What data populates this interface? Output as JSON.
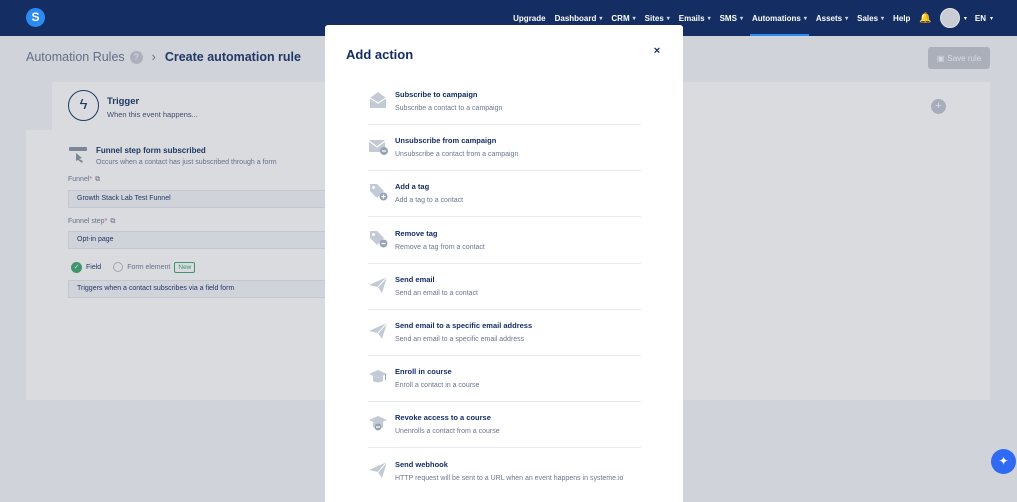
{
  "nav": {
    "items": [
      {
        "label": "Upgrade",
        "dropdown": false,
        "active": false
      },
      {
        "label": "Dashboard",
        "dropdown": true,
        "active": false
      },
      {
        "label": "CRM",
        "dropdown": true,
        "active": false
      },
      {
        "label": "Sites",
        "dropdown": true,
        "active": false
      },
      {
        "label": "Emails",
        "dropdown": true,
        "active": false
      },
      {
        "label": "SMS",
        "dropdown": true,
        "active": false
      },
      {
        "label": "Automations",
        "dropdown": true,
        "active": true
      },
      {
        "label": "Assets",
        "dropdown": true,
        "active": false
      },
      {
        "label": "Sales",
        "dropdown": true,
        "active": false
      },
      {
        "label": "Help",
        "dropdown": false,
        "active": false
      }
    ],
    "language": "EN",
    "logo": "S",
    "accent": "#2b8bf2"
  },
  "breadcrumb": {
    "root": "Automation Rules",
    "help": "?",
    "current": "Create automation rule"
  },
  "save_button": "Save rule",
  "trigger": {
    "title": "Trigger",
    "subtitle": "When this event happens..."
  },
  "funnel_trigger": {
    "title": "Funnel step form subscribed",
    "subtitle": "Occurs when a contact has just subscribed through a form",
    "funnel_label": "Funnel",
    "funnel_value": "Growth Stack Lab Test Funnel",
    "step_label": "Funnel step",
    "step_value": "Opt-in page",
    "radio_field": "Field",
    "radio_form": "Form element",
    "new_badge": "New",
    "description": "Triggers when a contact subscribes via a field form"
  },
  "modal": {
    "title": "Add action",
    "close": "×",
    "actions": [
      {
        "title": "Subscribe to campaign",
        "subtitle": "Subscribe a contact to a campaign",
        "icon": "envelope-open-icon"
      },
      {
        "title": "Unsubscribe from campaign",
        "subtitle": "Unsubscribe a contact from a campaign",
        "icon": "envelope-minus-icon"
      },
      {
        "title": "Add a tag",
        "subtitle": "Add a tag to a contact",
        "icon": "tag-plus-icon"
      },
      {
        "title": "Remove tag",
        "subtitle": "Remove a tag from a contact",
        "icon": "tag-minus-icon"
      },
      {
        "title": "Send email",
        "subtitle": "Send an email to a contact",
        "icon": "paper-plane-icon"
      },
      {
        "title": "Send email to a specific email address",
        "subtitle": "Send an email to a specific email address",
        "icon": "paper-plane-icon"
      },
      {
        "title": "Enroll in course",
        "subtitle": "Enroll a contact in a course",
        "icon": "graduation-cap-icon"
      },
      {
        "title": "Revoke access to a course",
        "subtitle": "Unenrolls a contact from a course",
        "icon": "graduation-cap-minus-icon"
      },
      {
        "title": "Send webhook",
        "subtitle": "HTTP request will be sent to a URL when an event happens in systeme.io",
        "icon": "paper-plane-icon"
      }
    ]
  }
}
